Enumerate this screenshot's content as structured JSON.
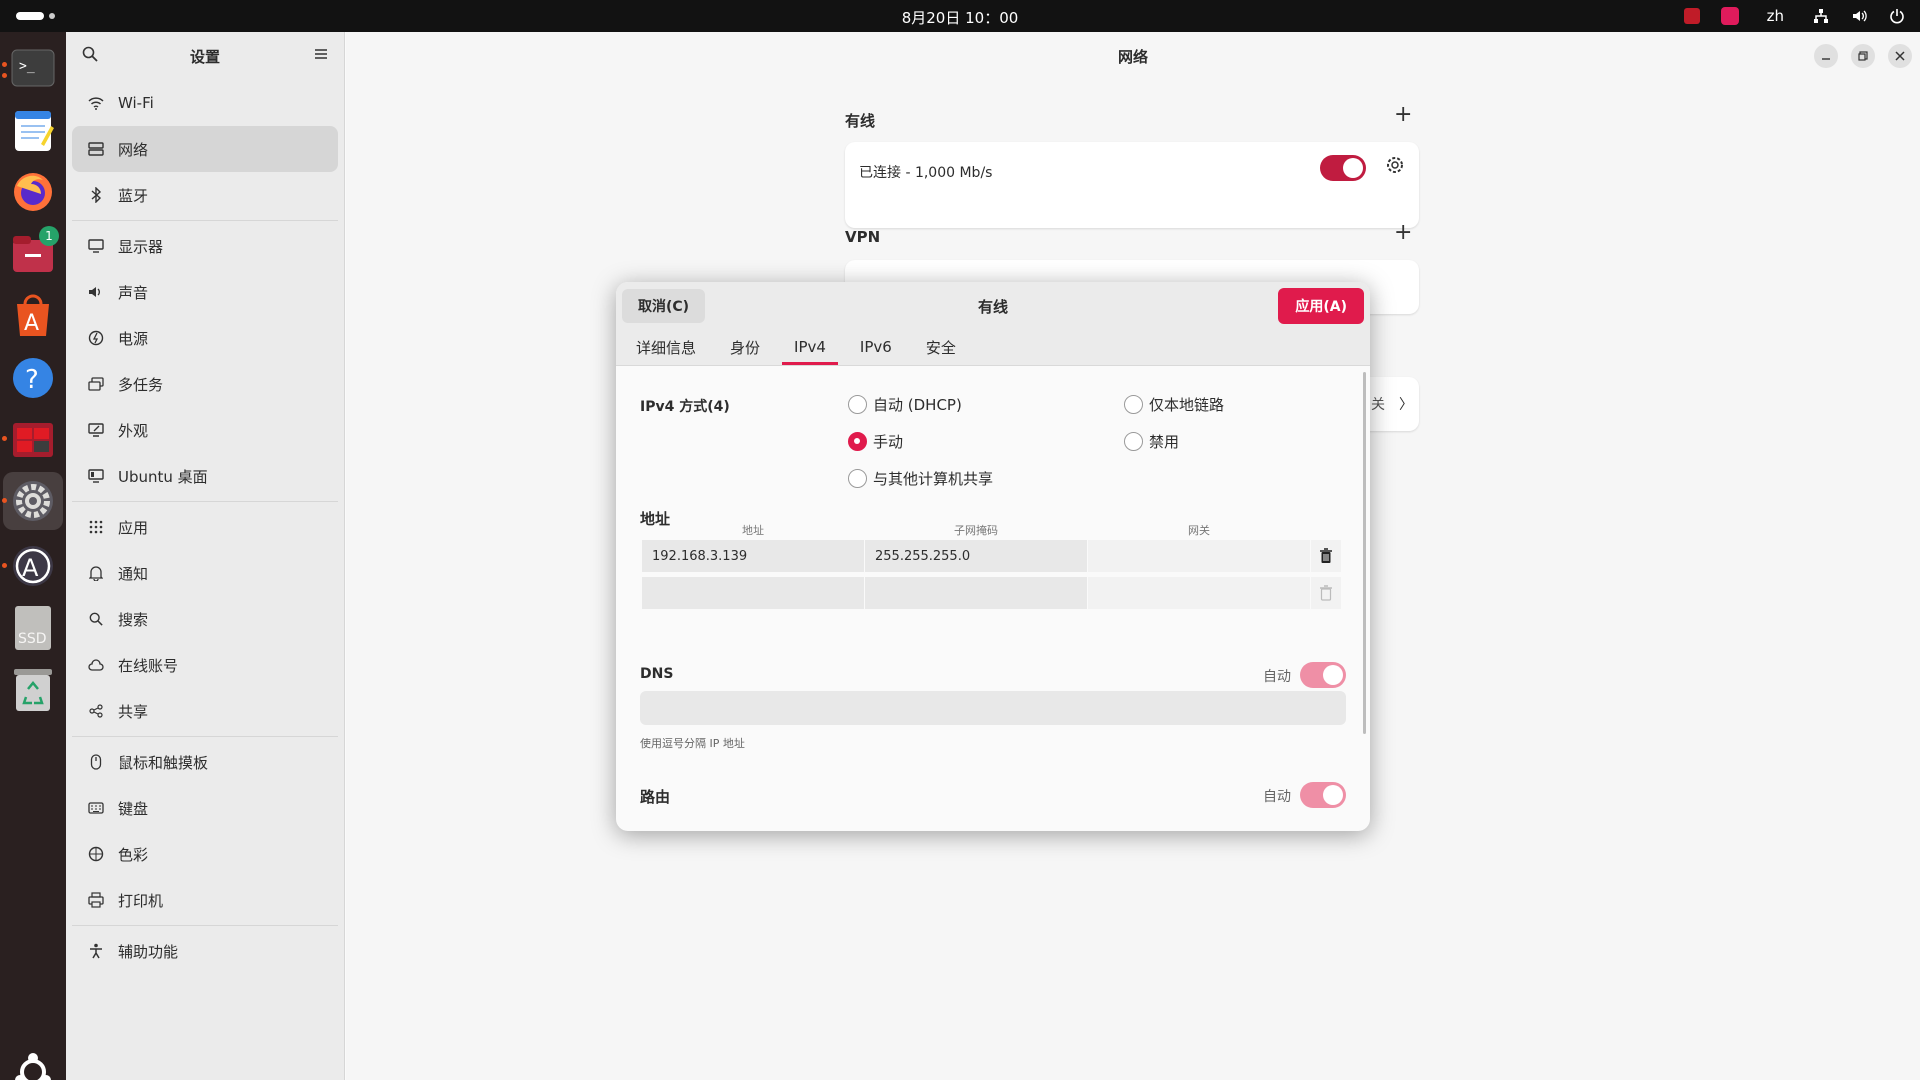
{
  "topbar": {
    "clock": "8月20日  10：00",
    "lang": "zh"
  },
  "dock": {
    "items": [
      "terminal",
      "text-editor",
      "firefox",
      "files",
      "app-store",
      "help",
      "screenshot-tool",
      "settings",
      "software-updater",
      "ssd-drive",
      "trash"
    ],
    "files_badge": "1",
    "ssd_label": "SSD"
  },
  "sidebar": {
    "title": "设置",
    "items": [
      {
        "label": "Wi-Fi"
      },
      {
        "label": "网络"
      },
      {
        "label": "蓝牙"
      },
      {
        "label": "显示器"
      },
      {
        "label": "声音"
      },
      {
        "label": "电源"
      },
      {
        "label": "多任务"
      },
      {
        "label": "外观"
      },
      {
        "label": "Ubuntu 桌面"
      },
      {
        "label": "应用"
      },
      {
        "label": "通知"
      },
      {
        "label": "搜索"
      },
      {
        "label": "在线账号"
      },
      {
        "label": "共享"
      },
      {
        "label": "鼠标和触摸板"
      },
      {
        "label": "键盘"
      },
      {
        "label": "色彩"
      },
      {
        "label": "打印机"
      },
      {
        "label": "辅助功能"
      }
    ]
  },
  "main": {
    "title": "网络",
    "wired": {
      "heading": "有线",
      "status": "已连接 - 1,000 Mb/s",
      "enabled": true
    },
    "vpn": {
      "heading": "VPN",
      "partial_text": "关"
    }
  },
  "dialog": {
    "title": "有线",
    "cancel_label": "取消(C)",
    "apply_label": "应用(A)",
    "tabs": [
      "详细信息",
      "身份",
      "IPv4",
      "IPv6",
      "安全"
    ],
    "active_tab": "IPv4",
    "ipv4_method_label": "IPv4 方式(4)",
    "methods": {
      "auto": "自动 (DHCP)",
      "link_local": "仅本地链路",
      "manual": "手动",
      "disabled": "禁用",
      "shared": "与其他计算机共享"
    },
    "selected_method": "manual",
    "address_section": "地址",
    "columns": {
      "address": "地址",
      "netmask": "子网掩码",
      "gateway": "网关"
    },
    "address_rows": [
      {
        "address": "192.168.3.139",
        "netmask": "255.255.255.0",
        "gateway": ""
      },
      {
        "address": "",
        "netmask": "",
        "gateway": ""
      }
    ],
    "dns": {
      "heading": "DNS",
      "auto_label": "自动",
      "auto": true,
      "value": "",
      "hint": "使用逗号分隔 IP 地址"
    },
    "routes": {
      "heading": "路由",
      "auto_label": "自动",
      "auto": true
    }
  },
  "colors": {
    "accent": "#e01b4c",
    "toggle_on": "#c01c40",
    "toggle_light": "#ef8fa6"
  }
}
